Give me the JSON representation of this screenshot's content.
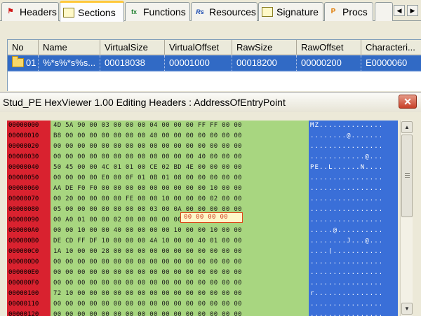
{
  "tabs": [
    {
      "label": "Headers",
      "icon": "headers-icon",
      "glyph": "⚑",
      "cls": "ic-red"
    },
    {
      "label": "Sections",
      "icon": "sections-icon",
      "glyph": "",
      "cls": "ic-doc"
    },
    {
      "label": "Functions",
      "icon": "functions-icon",
      "glyph": "fx",
      "cls": "ic-green"
    },
    {
      "label": "Resources",
      "icon": "resources-icon",
      "glyph": "Rs",
      "cls": "ic-blue"
    },
    {
      "label": "Signature",
      "icon": "signature-icon",
      "glyph": "",
      "cls": "ic-sig"
    },
    {
      "label": "Procs",
      "icon": "procs-icon",
      "glyph": "P",
      "cls": "ic-procs"
    }
  ],
  "tab_nav": {
    "left": "◀",
    "right": "▶"
  },
  "sections_table": {
    "headers": [
      "No",
      "Name",
      "VirtualSize",
      "VirtualOffset",
      "RawSize",
      "RawOffset",
      "Characteri..."
    ],
    "rows": [
      [
        "01",
        "%*s%*s%s...",
        "00018038",
        "00001000",
        "00018200",
        "00000200",
        "E0000060"
      ]
    ]
  },
  "hexviewer": {
    "title": "Stud_PE HexViewer 1.00 Editing Headers : AddressOfEntryPoint",
    "close_label": "✕",
    "highlight_bytes": "00 00 00 00",
    "lines": [
      {
        "off": "00000000",
        "hex": "4D 5A 90 00 03 00 00 00 04 00 00 00 FF FF 00 00",
        "ascii": "MZ.............."
      },
      {
        "off": "00000010",
        "hex": "B8 00 00 00 00 00 00 00 40 00 00 00 00 00 00 00",
        "ascii": "........@......."
      },
      {
        "off": "00000020",
        "hex": "00 00 00 00 00 00 00 00 00 00 00 00 00 00 00 00",
        "ascii": "................"
      },
      {
        "off": "00000030",
        "hex": "00 00 00 00 00 00 00 00 00 00 00 00 40 00 00 00",
        "ascii": "............@..."
      },
      {
        "off": "00000040",
        "hex": "50 45 00 00 4C 01 01 00 CE 02 BD 4E 00 00 00 00",
        "ascii": "PE..L......N...."
      },
      {
        "off": "00000050",
        "hex": "00 00 00 00 E0 00 0F 01 0B 01 08 00 00 00 00 00",
        "ascii": "................"
      },
      {
        "off": "00000060",
        "hex": "AA DE F0 F0 00 00 00 00 00 00 00 00 00 10 00 00",
        "ascii": "................"
      },
      {
        "off": "00000070",
        "hex": "00 20 00 00 00 00 FE 00 00 10 00 00 00 02 00 00",
        "ascii": "................"
      },
      {
        "off": "00000080",
        "hex": "05 00 00 00 00 00 00 00 03 00 0A 00 00 00 00 00",
        "ascii": "................"
      },
      {
        "off": "00000090",
        "hex": "00 A0 01 00 00 02 00 00 00 00 00 00 02 00 00 00",
        "ascii": "................"
      },
      {
        "off": "000000A0",
        "hex": "00 00 10 00 00 40 00 00 00 00 10 00 00 10 00 00",
        "ascii": ".....@.........."
      },
      {
        "off": "000000B0",
        "hex": "DE CD FF DF 10 00 00 00 4A 10 00 00 40 01 00 00",
        "ascii": "........J...@..."
      },
      {
        "off": "000000C0",
        "hex": "1A 10 00 00 28 00 00 00 00 00 00 00 00 00 00 00",
        "ascii": "....(..........."
      },
      {
        "off": "000000D0",
        "hex": "00 00 00 00 00 00 00 00 00 00 00 00 00 00 00 00",
        "ascii": "................"
      },
      {
        "off": "000000E0",
        "hex": "00 00 00 00 00 00 00 00 00 00 00 00 00 00 00 00",
        "ascii": "................"
      },
      {
        "off": "000000F0",
        "hex": "00 00 00 00 00 00 00 00 00 00 00 00 00 00 00 00",
        "ascii": "................"
      },
      {
        "off": "00000100",
        "hex": "72 10 00 00 00 00 00 00 00 00 00 00 00 00 00 00",
        "ascii": "r..............."
      },
      {
        "off": "00000110",
        "hex": "00 00 00 00 00 00 00 00 00 00 00 00 00 00 00 00",
        "ascii": "................"
      },
      {
        "off": "00000120",
        "hex": "00 00 00 00 00 00 00 00 00 00 00 00 00 00 00 00",
        "ascii": "................"
      }
    ]
  },
  "scroll": {
    "up": "▲",
    "down": "▼"
  },
  "colors": {
    "offset_col": "#d9222f",
    "hex_col": "#a8d680",
    "ascii_col": "#3a6fd8",
    "selection": "#316ac5",
    "highlight_border": "#e0471a"
  }
}
